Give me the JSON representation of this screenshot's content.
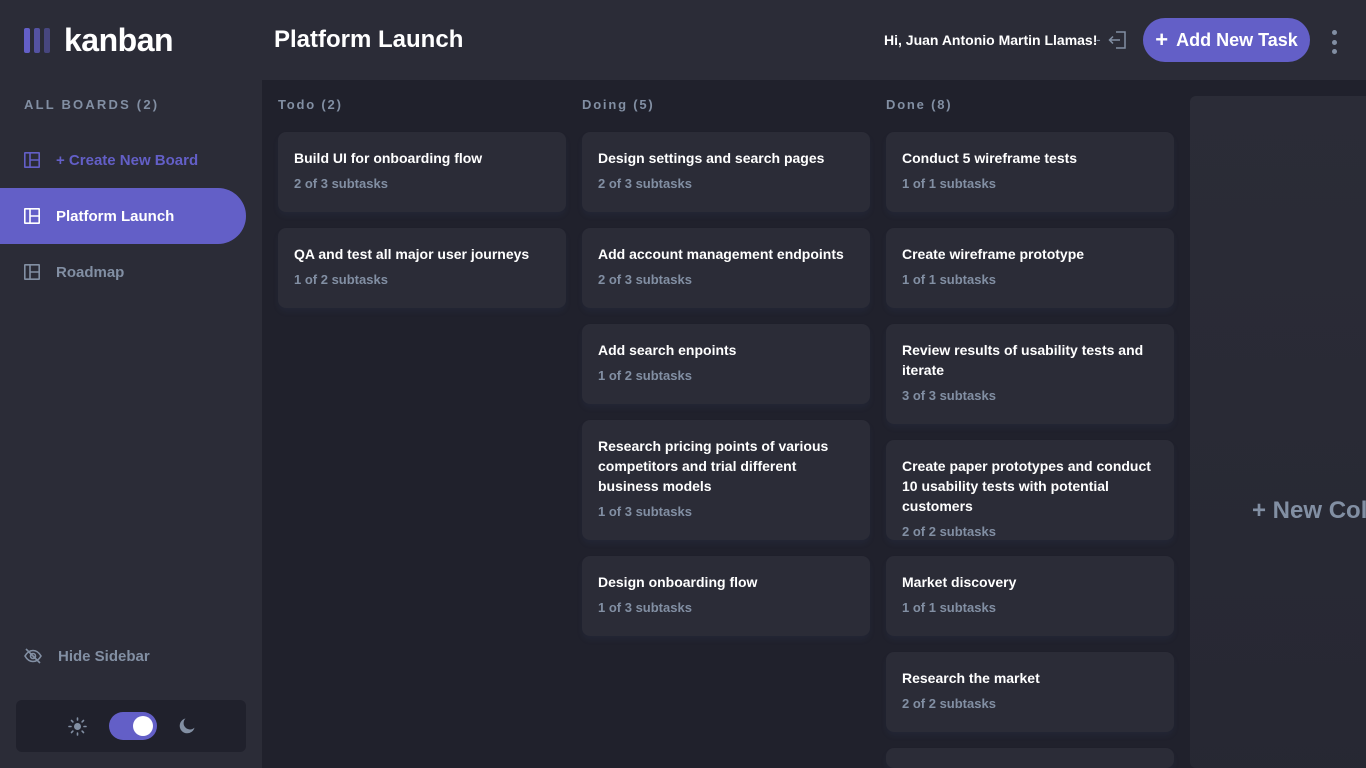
{
  "app": {
    "logo_text": "kanban",
    "accent": "#635fc7"
  },
  "sidebar": {
    "heading": "ALL BOARDS (2)",
    "create_label": "+ Create New Board",
    "boards": [
      {
        "label": "Platform Launch",
        "active": true
      },
      {
        "label": "Roadmap",
        "active": false
      }
    ],
    "hide_label": "Hide Sidebar",
    "theme": {
      "mode": "dark"
    }
  },
  "header": {
    "title": "Platform Launch",
    "greeting": "Hi, Juan Antonio Martin Llamas!",
    "separator": "-",
    "add_task_label": "Add New Task"
  },
  "columns": [
    {
      "title": "Todo (2)",
      "tasks": [
        {
          "title": "Build UI for onboarding flow",
          "subtasks": "2 of 3 subtasks"
        },
        {
          "title": "QA and test all major user journeys",
          "subtasks": "1 of 2 subtasks"
        }
      ]
    },
    {
      "title": "Doing (5)",
      "tasks": [
        {
          "title": "Design settings and search pages",
          "subtasks": "2 of 3 subtasks"
        },
        {
          "title": "Add account management endpoints",
          "subtasks": "2 of 3 subtasks"
        },
        {
          "title": "Add search enpoints",
          "subtasks": "1 of 2 subtasks"
        },
        {
          "title": "Research pricing points of various competitors and trial different business models",
          "subtasks": "1 of 3 subtasks"
        },
        {
          "title": "Design onboarding flow",
          "subtasks": "1 of 3 subtasks"
        }
      ]
    },
    {
      "title": "Done (8)",
      "tasks": [
        {
          "title": "Conduct 5 wireframe tests",
          "subtasks": "1 of 1 subtasks"
        },
        {
          "title": "Create wireframe prototype",
          "subtasks": "1 of 1 subtasks"
        },
        {
          "title": "Review results of usability tests and iterate",
          "subtasks": "3 of 3 subtasks"
        },
        {
          "title": "Create paper prototypes and conduct 10 usability tests with potential customers",
          "subtasks": "2 of 2 subtasks"
        },
        {
          "title": "Market discovery",
          "subtasks": "1 of 1 subtasks"
        },
        {
          "title": "Research the market",
          "subtasks": "2 of 2 subtasks"
        }
      ]
    }
  ],
  "new_column_label": "+ New Column"
}
